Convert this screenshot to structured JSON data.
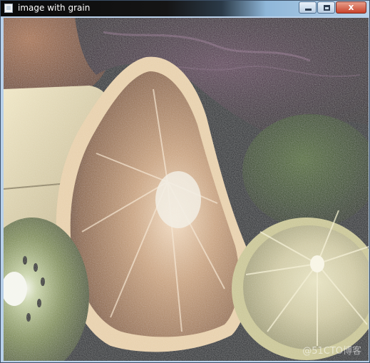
{
  "window": {
    "title": "image with grain",
    "controls": {
      "minimize_icon": "minimize-icon",
      "maximize_icon": "maximize-icon",
      "close_icon": "close-icon",
      "close_glyph": "x"
    }
  },
  "image": {
    "watermark": "@51CTO博客"
  }
}
